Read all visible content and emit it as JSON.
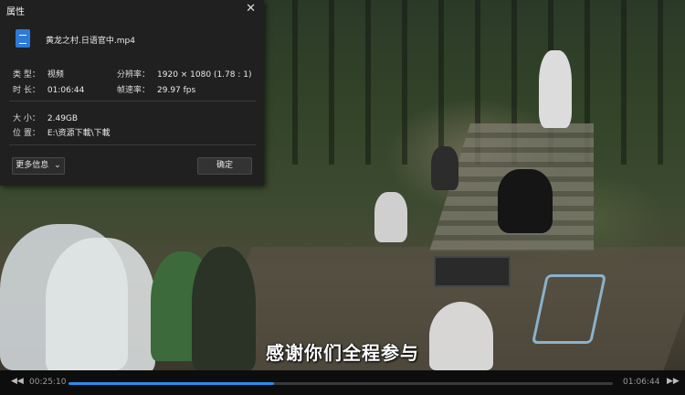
{
  "dialog": {
    "title": "属性",
    "file_name": "黄龙之村.日语官中.mp4",
    "type_label": "类 型：",
    "type_value": "视频",
    "duration_label": "时 长：",
    "duration_value": "01:06:44",
    "resolution_label": "分辨率：",
    "resolution_value": "1920 × 1080 (1.78 : 1)",
    "framerate_label": "帧速率：",
    "framerate_value": "29.97 fps",
    "size_label": "大 小：",
    "size_value": "2.49GB",
    "location_label": "位 置：",
    "location_value": "E:\\资源下載\\下載",
    "more_info_label": "更多信息",
    "ok_label": "确定"
  },
  "video": {
    "subtitle": "感谢你们全程参与"
  },
  "player": {
    "current_time": "00:25:10",
    "total_time": "01:06:44",
    "progress": 0.377,
    "accent_color": "#2d8ceb"
  }
}
